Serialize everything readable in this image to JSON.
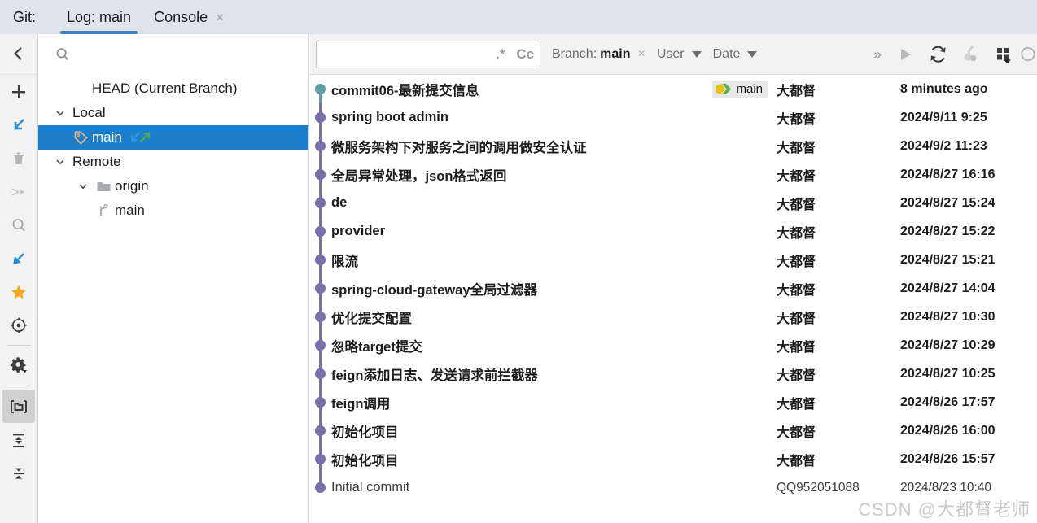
{
  "window": {
    "vcs_label": "Git:",
    "tabs": [
      {
        "label": "Log: main",
        "active": true,
        "closable": false
      },
      {
        "label": "Console",
        "active": false,
        "closable": true,
        "close_glyph": "×"
      }
    ]
  },
  "rail": {
    "items": [
      {
        "name": "new-branch",
        "icon": "plus-icon"
      },
      {
        "name": "checkout",
        "icon": "arrow-down-left-icon"
      },
      {
        "name": "delete-branch",
        "icon": "trash-icon"
      },
      {
        "name": "merge",
        "icon": "merge-arrows-icon"
      },
      {
        "name": "search",
        "icon": "search-icon"
      },
      {
        "name": "pull",
        "icon": "arrow-down-left-blue-icon"
      },
      {
        "name": "favorite",
        "icon": "star-icon"
      },
      {
        "name": "show-current",
        "icon": "target-icon"
      },
      {
        "name": "settings",
        "icon": "gear-icon"
      },
      {
        "name": "group-by-directory",
        "icon": "folder-bracket-icon"
      },
      {
        "name": "expand-all",
        "icon": "expand-all-icon"
      },
      {
        "name": "collapse-all",
        "icon": "collapse-all-icon"
      }
    ]
  },
  "sidebar": {
    "collapse_icon": "chevron-left-icon",
    "search": {
      "value": "",
      "placeholder": "",
      "icon": "search-icon"
    },
    "tree": [
      {
        "label": "HEAD (Current Branch)",
        "indent": 1,
        "twisty": "",
        "icon": "",
        "selected": false
      },
      {
        "label": "Local",
        "indent": 0,
        "twisty": "expanded",
        "icon": "",
        "selected": false
      },
      {
        "label": "main",
        "indent": 1,
        "twisty": "",
        "icon": "tag-icon",
        "selected": true,
        "sync": true
      },
      {
        "label": "Remote",
        "indent": 0,
        "twisty": "expanded",
        "icon": "",
        "selected": false
      },
      {
        "label": "origin",
        "indent": 1,
        "twisty": "expanded",
        "icon": "folder-icon",
        "selected": false
      },
      {
        "label": "main",
        "indent": 2,
        "twisty": "",
        "icon": "branch-icon",
        "selected": false
      }
    ]
  },
  "toolbar": {
    "search": {
      "value": "",
      "placeholder": "",
      "icon": "search-dropdown-icon"
    },
    "regex_toggle": ".*",
    "case_toggle": "Cc",
    "filters": [
      {
        "name": "branch-filter",
        "prefix": "Branch:",
        "value": "main",
        "closable": true,
        "close_glyph": "×"
      },
      {
        "name": "user-filter",
        "label": "User",
        "dropdown": true
      },
      {
        "name": "date-filter",
        "label": "Date",
        "dropdown": true
      }
    ],
    "overflow_glyph": "»",
    "actions": [
      {
        "name": "apply-filters-button",
        "icon": "play-icon"
      },
      {
        "name": "refresh-button",
        "icon": "refresh-icon"
      },
      {
        "name": "cherry-pick-button",
        "icon": "cherry-pick-icon"
      },
      {
        "name": "column-chooser-button",
        "icon": "grid-dropdown-icon"
      },
      {
        "name": "help-button",
        "icon": "circle-icon"
      }
    ]
  },
  "log": {
    "graph": {
      "head_node_color": "#5e9ea6",
      "node_color": "#7a6fa8",
      "edge_color": "#7a6fa8",
      "head_edge_color": "#5e9ea6"
    },
    "commits": [
      {
        "subject": "commit06-最新提交信息",
        "ref": "main",
        "author": "大都督",
        "date": "8 minutes ago",
        "head": true
      },
      {
        "subject": "spring boot admin",
        "ref": "",
        "author": "大都督",
        "date": "2024/9/11 9:25",
        "head": false
      },
      {
        "subject": "微服务架构下对服务之间的调用做安全认证",
        "ref": "",
        "author": "大都督",
        "date": "2024/9/2 11:23",
        "head": false
      },
      {
        "subject": "全局异常处理，json格式返回",
        "ref": "",
        "author": "大都督",
        "date": "2024/8/27 16:16",
        "head": false
      },
      {
        "subject": "de",
        "ref": "",
        "author": "大都督",
        "date": "2024/8/27 15:24",
        "head": false
      },
      {
        "subject": "provider",
        "ref": "",
        "author": "大都督",
        "date": "2024/8/27 15:22",
        "head": false
      },
      {
        "subject": "限流",
        "ref": "",
        "author": "大都督",
        "date": "2024/8/27 15:21",
        "head": false
      },
      {
        "subject": "spring-cloud-gateway全局过滤器",
        "ref": "",
        "author": "大都督",
        "date": "2024/8/27 14:04",
        "head": false
      },
      {
        "subject": "优化提交配置",
        "ref": "",
        "author": "大都督",
        "date": "2024/8/27 10:30",
        "head": false
      },
      {
        "subject": "忽略target提交",
        "ref": "",
        "author": "大都督",
        "date": "2024/8/27 10:29",
        "head": false
      },
      {
        "subject": "feign添加日志、发送请求前拦截器",
        "ref": "",
        "author": "大都督",
        "date": "2024/8/27 10:25",
        "head": false
      },
      {
        "subject": "feign调用",
        "ref": "",
        "author": "大都督",
        "date": "2024/8/26 17:57",
        "head": false
      },
      {
        "subject": "初始化项目",
        "ref": "",
        "author": "大都督",
        "date": "2024/8/26 16:00",
        "head": false
      },
      {
        "subject": "初始化项目",
        "ref": "",
        "author": "大都督",
        "date": "2024/8/26 15:57",
        "head": false
      },
      {
        "subject": "Initial commit",
        "ref": "",
        "author": "QQ952051088",
        "date": "2024/8/23 10:40",
        "head": false,
        "faded": true
      }
    ]
  },
  "watermark": "CSDN @大都督老师"
}
